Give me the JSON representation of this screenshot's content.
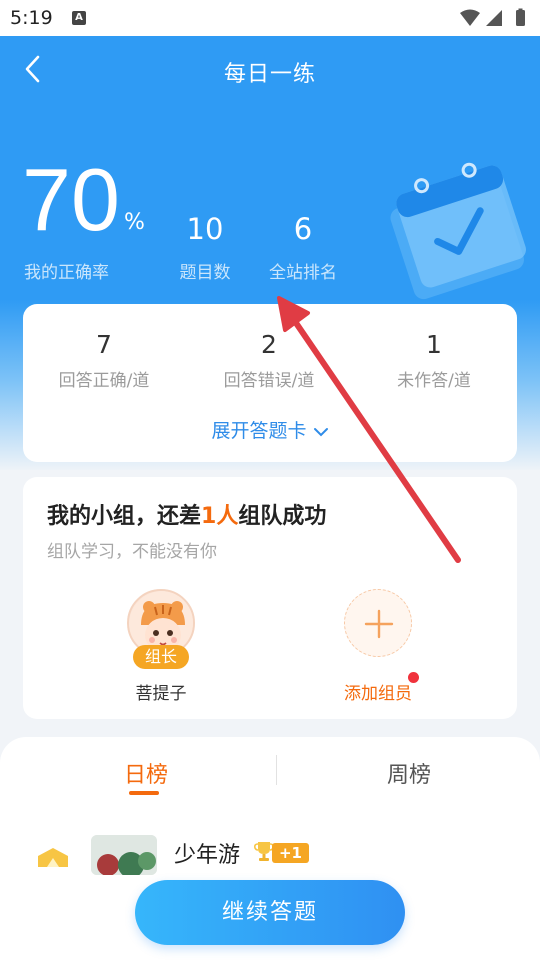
{
  "status_bar": {
    "time": "5:19",
    "notification_letter": "A"
  },
  "header": {
    "title": "每日一练"
  },
  "summary": {
    "accuracy_value": "70",
    "accuracy_unit": "%",
    "accuracy_label": "我的正确率",
    "question_count": "10",
    "question_count_label": "题目数",
    "site_rank": "6",
    "site_rank_label": "全站排名"
  },
  "answer_stats": {
    "items": [
      {
        "value": "7",
        "label": "回答正确/道"
      },
      {
        "value": "2",
        "label": "回答错误/道"
      },
      {
        "value": "1",
        "label": "未作答/道"
      }
    ],
    "expand_label": "展开答题卡"
  },
  "group": {
    "title_prefix": "我的小组，还差",
    "title_highlight": "1人",
    "title_suffix": "组队成功",
    "subtitle": "组队学习，不能没有你",
    "leader_badge": "组长",
    "leader_name": "菩提子",
    "add_member_label": "添加组员"
  },
  "ranking": {
    "tabs": [
      {
        "label": "日榜",
        "active": true
      },
      {
        "label": "周榜",
        "active": false
      }
    ],
    "first_entry": {
      "name": "少年游",
      "badge": "+1"
    }
  },
  "actions": {
    "continue_label": "继续答题"
  },
  "colors": {
    "primary_blue": "#2f9bf4",
    "accent_orange": "#f46a0e",
    "arrow_red": "#e03c44"
  }
}
